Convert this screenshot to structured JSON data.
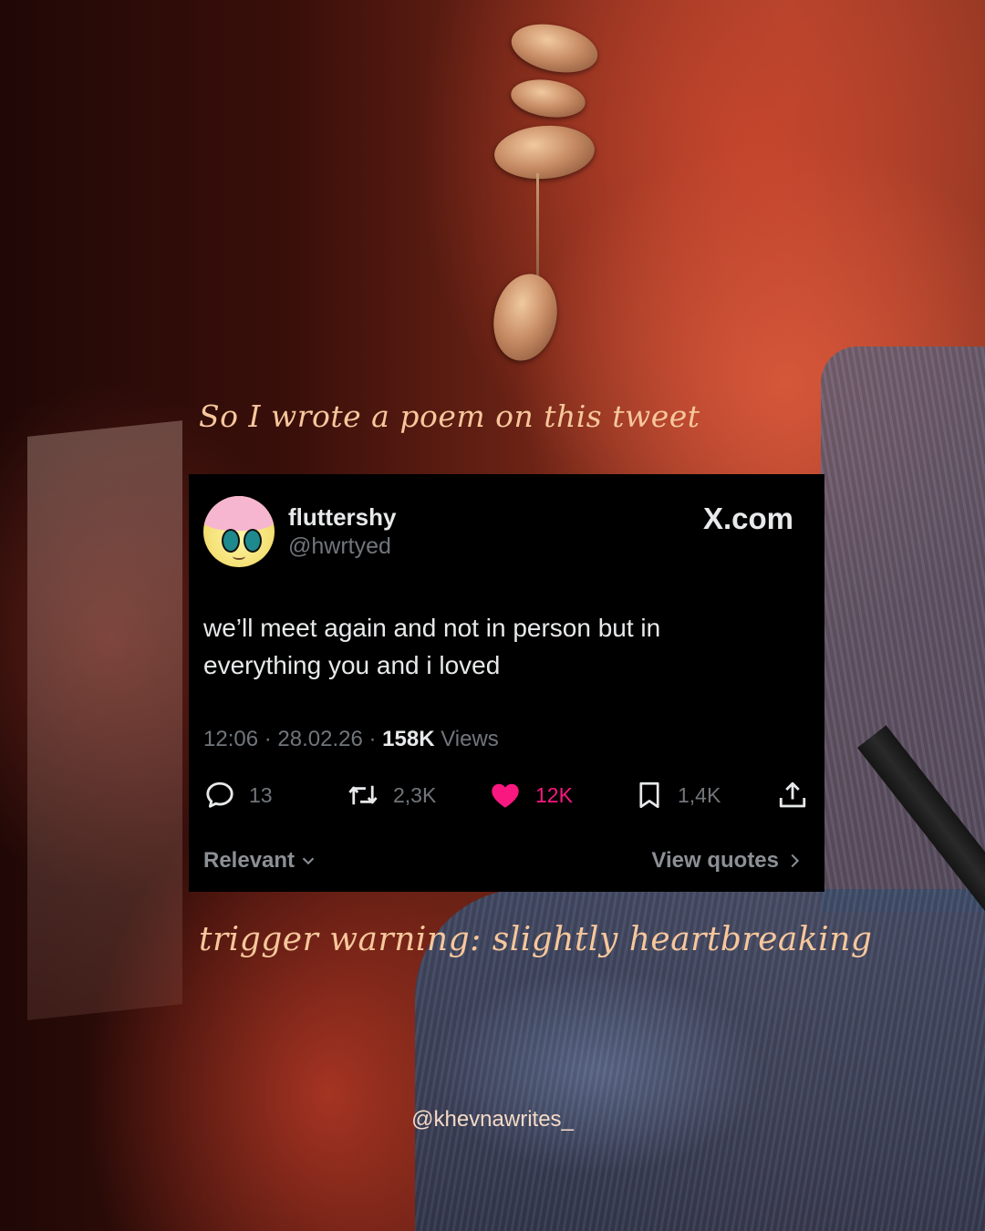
{
  "overlay": {
    "top_caption": "So I wrote a poem on this tweet",
    "bottom_caption": "trigger warning: slightly heartbreaking",
    "credit_handle": "@khevnawrites_"
  },
  "tweet": {
    "display_name": "fluttershy",
    "handle": "@hwrtyed",
    "brand": "X.com",
    "text_line1": "we’ll meet again and not in person but in",
    "text_line2": "everything you and i loved",
    "time": "12:06",
    "date": "28.02.26",
    "separator": "·",
    "views_count": "158K",
    "views_label": "Views",
    "replies": "13",
    "reposts": "2,3K",
    "likes": "12K",
    "bookmarks": "1,4K",
    "sort_label": "Relevant",
    "view_quotes_label": "View quotes"
  },
  "icons": {
    "reply": "reply-bubble-icon",
    "repost": "repost-arrows-icon",
    "like": "heart-icon",
    "bookmark": "bookmark-icon",
    "share": "share-upload-icon",
    "sort": "chevron-down-icon",
    "quotes": "chevron-right-icon"
  },
  "colors": {
    "card_background": "#000000",
    "primary_text": "#e7e9ea",
    "secondary_text": "#71767b",
    "like_pink": "#f91880",
    "caption_peach": "#f7c79c"
  }
}
